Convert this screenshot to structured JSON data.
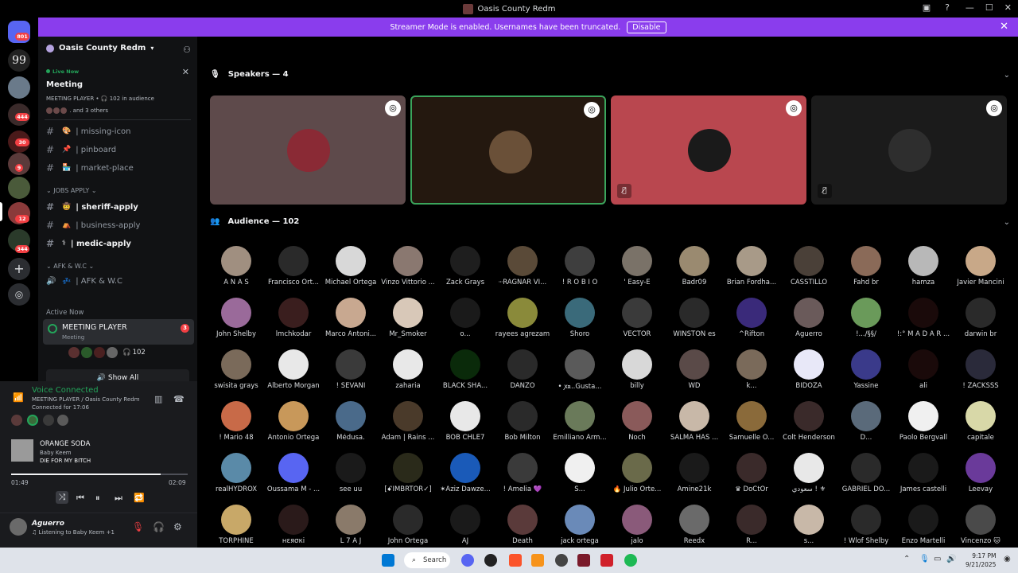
{
  "window": {
    "title": "Oasis County Redm"
  },
  "banner": {
    "text": "Streamer Mode is enabled. Usernames have been truncated.",
    "button": "Disable"
  },
  "guilds": {
    "badges": [
      "801",
      "444",
      "30",
      "9",
      "12",
      "344"
    ]
  },
  "channels": {
    "server_name": "Oasis County Redm",
    "live_now": "Live Now",
    "meeting_title": "Meeting",
    "meeting_sub": "MEETING PLAYER • 🎧 102 in audience",
    "others": ". and 3 others",
    "items": [
      {
        "label": "| missing-icon",
        "bold": false
      },
      {
        "label": "| pinboard",
        "bold": false
      },
      {
        "label": "| market-place",
        "bold": false
      }
    ],
    "cat_jobs": "JOBS APPLY",
    "jobs": [
      {
        "label": "| sheriff-apply",
        "bold": true
      },
      {
        "label": "| business-apply",
        "bold": false
      },
      {
        "label": "| medic-apply",
        "bold": true
      }
    ],
    "cat_afk": "AFK & W.C",
    "afk_label": "| AFK & W.C",
    "active_now": "Active Now",
    "active_title": "MEETING PLAYER",
    "active_sub": "Meeting",
    "active_badge": "3",
    "active_count": "102",
    "show_all": "Show All"
  },
  "voice": {
    "title": "Voice Connected",
    "channel": "MEETING PLAYER / Oasis County Redm",
    "connected": "Connected for 17:06"
  },
  "music": {
    "song": "ORANGE SODA",
    "artist": "Baby Keem",
    "album": "DIE FOR MY BITCH",
    "elapsed": "01:49",
    "total": "02:09",
    "progress": 0.845
  },
  "user": {
    "name": "Aguerro",
    "status": "Listening to Baby Keem +1"
  },
  "stage": {
    "speakers_label": "Speakers — 4",
    "audience_label": "Audience — 102",
    "speakers": [
      {
        "bg": "#5e4a4b",
        "avatar": "#8a2a35",
        "muted": false
      },
      {
        "bg": "#24180f",
        "avatar": "#6a5038",
        "muted": false,
        "speaking": true
      },
      {
        "bg": "#b9474f",
        "avatar": "#1a1a1a",
        "muted": true
      },
      {
        "bg": "#1b1b1b",
        "avatar": "#2e2e2e",
        "muted": true
      }
    ],
    "audience": [
      {
        "name": "A N A S",
        "color": "#a08f80"
      },
      {
        "name": "Francisco Ort...",
        "color": "#2a2a2a"
      },
      {
        "name": "Michael Ortega",
        "color": "#d8d8d8"
      },
      {
        "name": "Vinzo Vittorio ...",
        "color": "#8a7870"
      },
      {
        "name": "Zack Grays",
        "color": "#1e1e1e"
      },
      {
        "name": "ⵈRAGNAR VI...",
        "color": "#5a4a38"
      },
      {
        "name": "! R O B I O",
        "color": "#3e3e3e"
      },
      {
        "name": "' Easy-E",
        "color": "#7a7268"
      },
      {
        "name": "Badr09",
        "color": "#9a8a70"
      },
      {
        "name": "Brian Fordha...",
        "color": "#a89a88"
      },
      {
        "name": "CASSTILLO",
        "color": "#4a4038"
      },
      {
        "name": "Fahd br",
        "color": "#8a6a58"
      },
      {
        "name": "hamza",
        "color": "#b8b8b8"
      },
      {
        "name": "Javier Mancini",
        "color": "#c8a888"
      },
      {
        "name": "John Shelby",
        "color": "#9a6a9a"
      },
      {
        "name": "lmchkodar",
        "color": "#3a1e1e"
      },
      {
        "name": "Marco Antoni...",
        "color": "#c8a890"
      },
      {
        "name": "Mr_Smoker",
        "color": "#d8c8b8"
      },
      {
        "name": "o...",
        "color": "#1a1a1a"
      },
      {
        "name": "rayees agrezam",
        "color": "#8a8a3a"
      },
      {
        "name": "Shoro",
        "color": "#3a6a7a"
      },
      {
        "name": "VECTOR",
        "color": "#3a3a3a"
      },
      {
        "name": "WINSTON es",
        "color": "#2a2a2a"
      },
      {
        "name": "^Rifton",
        "color": "#3a2a7a"
      },
      {
        "name": "Aguerro",
        "color": "#6a5a5a"
      },
      {
        "name": "!.../§§/",
        "color": "#6a9a5a"
      },
      {
        "name": "!:° M A D A R ...",
        "color": "#1a0a0a"
      },
      {
        "name": "darwin br",
        "color": "#2a2a2a"
      },
      {
        "name": "swisita grays",
        "color": "#7a6a5a"
      },
      {
        "name": "Alberto Morgan",
        "color": "#e8e8e8"
      },
      {
        "name": "! SEVANI",
        "color": "#3a3a3a"
      },
      {
        "name": "zaharia",
        "color": "#e8e8e8"
      },
      {
        "name": "BLACK SHA...",
        "color": "#0a2a0a"
      },
      {
        "name": "DANZO",
        "color": "#2a2a2a"
      },
      {
        "name": "• ꭗꭱ..Gusta...",
        "color": "#5a5a5a"
      },
      {
        "name": "billy",
        "color": "#d8d8d8"
      },
      {
        "name": "WD",
        "color": "#5a4a48"
      },
      {
        "name": "k...",
        "color": "#7a6a5a"
      },
      {
        "name": "BIDOZA",
        "color": "#e8e8f8"
      },
      {
        "name": "Yassine",
        "color": "#3a3a8a"
      },
      {
        "name": "ali",
        "color": "#1a0a0a"
      },
      {
        "name": "! ZACKSSS",
        "color": "#2a2a3a"
      },
      {
        "name": "! Mario 48",
        "color": "#c86a48"
      },
      {
        "name": "Antonio Ortega",
        "color": "#c8985a"
      },
      {
        "name": "Médusa.",
        "color": "#4a6a8a"
      },
      {
        "name": "Adam | Rains ...",
        "color": "#4a3a2a"
      },
      {
        "name": "BOB CHLE7",
        "color": "#e8e8e8"
      },
      {
        "name": "Bob Milton",
        "color": "#2a2a2a"
      },
      {
        "name": "Emilliano Arm...",
        "color": "#6a7a5a"
      },
      {
        "name": "Noch",
        "color": "#8a5a5a"
      },
      {
        "name": "SALMA HAS ...",
        "color": "#c8b8a8"
      },
      {
        "name": "Samuelle O...",
        "color": "#8a6a3a"
      },
      {
        "name": "Colt Henderson",
        "color": "#3a2a2a"
      },
      {
        "name": "D...",
        "color": "#5a6a7a"
      },
      {
        "name": "Paolo Bergvall",
        "color": "#f0f0f0"
      },
      {
        "name": "capitale",
        "color": "#d8d8a8"
      },
      {
        "name": "realHYDROX",
        "color": "#5a8aa8"
      },
      {
        "name": "Oussama M - ...",
        "color": "#5865f2"
      },
      {
        "name": "see uu",
        "color": "#1a1a1a"
      },
      {
        "name": "[ꗃIMBRTOR✓]",
        "color": "#2a2a1a"
      },
      {
        "name": "✶Aziz Dawze...",
        "color": "#1a5ab8"
      },
      {
        "name": "! Amelia 💜",
        "color": "#3a3a3a"
      },
      {
        "name": "S...",
        "color": "#f0f0f0"
      },
      {
        "name": "🔥 Julio Orte...",
        "color": "#6a6a4a"
      },
      {
        "name": "Amine21k",
        "color": "#1a1a1a"
      },
      {
        "name": "♛ DoCtOr",
        "color": "#3a2a2a"
      },
      {
        "name": "سعودي ! ⚜",
        "color": "#e8e8e8"
      },
      {
        "name": "GABRIEL DO...",
        "color": "#2a2a2a"
      },
      {
        "name": "James castelli",
        "color": "#1a1a1a"
      },
      {
        "name": "Leevay",
        "color": "#6a3a9a"
      },
      {
        "name": "TORPHINE",
        "color": "#c8a868"
      },
      {
        "name": "нεяσкі",
        "color": "#2a1a1a"
      },
      {
        "name": "L 7 A J",
        "color": "#8a7a6a"
      },
      {
        "name": "John Ortega",
        "color": "#2a2a2a"
      },
      {
        "name": "AJ",
        "color": "#1a1a1a"
      },
      {
        "name": "Death",
        "color": "#5a3a3a"
      },
      {
        "name": "jack ortega",
        "color": "#6a8ab8"
      },
      {
        "name": "jalo",
        "color": "#8a5a7a"
      },
      {
        "name": "Reedx",
        "color": "#6a6a6a"
      },
      {
        "name": "R...",
        "color": "#3a2a2a"
      },
      {
        "name": "s...",
        "color": "#c8b8a8"
      },
      {
        "name": "! Wlof Shelby",
        "color": "#2a2a2a"
      },
      {
        "name": "Enzo Martelli",
        "color": "#1a1a1a"
      },
      {
        "name": "Vincenzo 🐱",
        "color": "#4a4a4a"
      }
    ]
  },
  "taskbar": {
    "search": "Search",
    "time": "9:17 PM",
    "date": "9/21/2025"
  }
}
